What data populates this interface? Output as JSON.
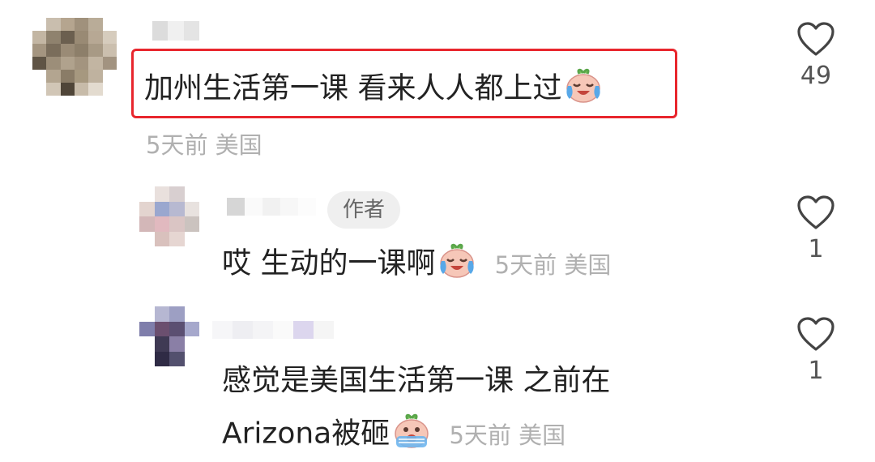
{
  "comments": [
    {
      "text": "加州生活第一课 看来人人都上过",
      "emoji": "crying-face-emoji",
      "time": "5天前",
      "location": "美国",
      "likes": "49"
    },
    {
      "badge": "作者",
      "text": "哎 生动的一课啊",
      "emoji": "crying-face-emoji",
      "time": "5天前",
      "location": "美国",
      "likes": "1"
    },
    {
      "text_line1": "感觉是美国生活第一课 之前在",
      "text_line2": "Arizona被砸",
      "emoji": "screaming-crying-face-emoji",
      "time": "5天前",
      "location": "美国",
      "likes": "1"
    }
  ],
  "colors": {
    "highlight": "#e8262d",
    "meta_text": "#b0b0b0",
    "badge_bg": "#efefef",
    "heart_outline": "#444444"
  }
}
